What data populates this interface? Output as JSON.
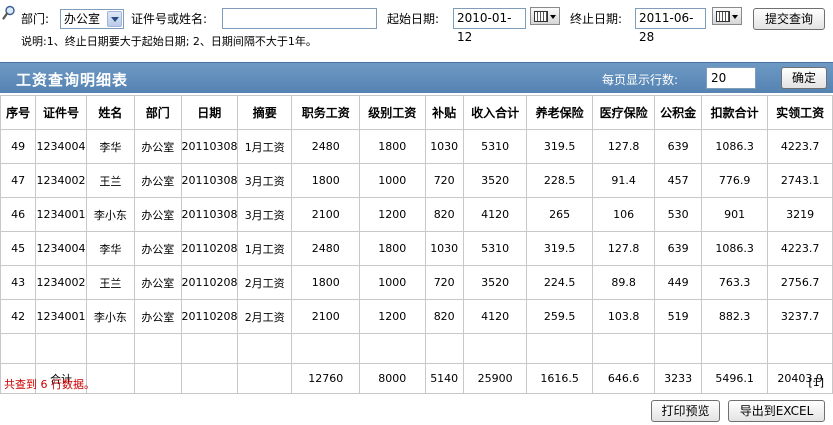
{
  "filter": {
    "dept_label": "部门:",
    "dept_value": "办公室",
    "id_label": "证件号或姓名:",
    "id_value": "",
    "start_label": "起始日期:",
    "start_value": "2010-01-12",
    "end_label": "终止日期:",
    "end_value": "2011-06-28",
    "submit_label": "提交查询",
    "note": "说明:1、终止日期要大于起始日期; 2、日期间隔不大于1年。"
  },
  "title_bar": {
    "title": "工资查询明细表",
    "per_page_label": "每页显示行数:",
    "per_page_value": "20",
    "confirm_label": "确定"
  },
  "table": {
    "headers": [
      "序号",
      "证件号",
      "姓名",
      "部门",
      "日期",
      "摘要",
      "职务工资",
      "级别工资",
      "补贴",
      "收入合计",
      "养老保险",
      "医疗保险",
      "公积金",
      "扣款合计",
      "实领工资"
    ],
    "rows": [
      [
        "49",
        "1234004",
        "李华",
        "办公室",
        "20110308",
        "1月工资",
        "2480",
        "1800",
        "1030",
        "5310",
        "319.5",
        "127.8",
        "639",
        "1086.3",
        "4223.7"
      ],
      [
        "47",
        "1234002",
        "王兰",
        "办公室",
        "20110308",
        "3月工资",
        "1800",
        "1000",
        "720",
        "3520",
        "228.5",
        "91.4",
        "457",
        "776.9",
        "2743.1"
      ],
      [
        "46",
        "1234001",
        "李小东",
        "办公室",
        "20110308",
        "3月工资",
        "2100",
        "1200",
        "820",
        "4120",
        "265",
        "106",
        "530",
        "901",
        "3219"
      ],
      [
        "45",
        "1234004",
        "李华",
        "办公室",
        "20110208",
        "1月工资",
        "2480",
        "1800",
        "1030",
        "5310",
        "319.5",
        "127.8",
        "639",
        "1086.3",
        "4223.7"
      ],
      [
        "43",
        "1234002",
        "王兰",
        "办公室",
        "20110208",
        "2月工资",
        "1800",
        "1000",
        "720",
        "3520",
        "224.5",
        "89.8",
        "449",
        "763.3",
        "2756.7"
      ],
      [
        "42",
        "1234001",
        "李小东",
        "办公室",
        "20110208",
        "2月工资",
        "2100",
        "1200",
        "820",
        "4120",
        "259.5",
        "103.8",
        "519",
        "882.3",
        "3237.7"
      ]
    ],
    "total_row": [
      "",
      "合计",
      "",
      "",
      "",
      "",
      "12760",
      "8000",
      "5140",
      "25900",
      "1616.5",
      "646.6",
      "3233",
      "5496.1",
      "20403.9"
    ]
  },
  "footer": {
    "count_prefix": "共查到",
    "count_value": "6",
    "count_suffix": "行数据。",
    "page_link": "[1]",
    "print_label": "打印预览",
    "excel_label": "导出到EXCEL"
  }
}
